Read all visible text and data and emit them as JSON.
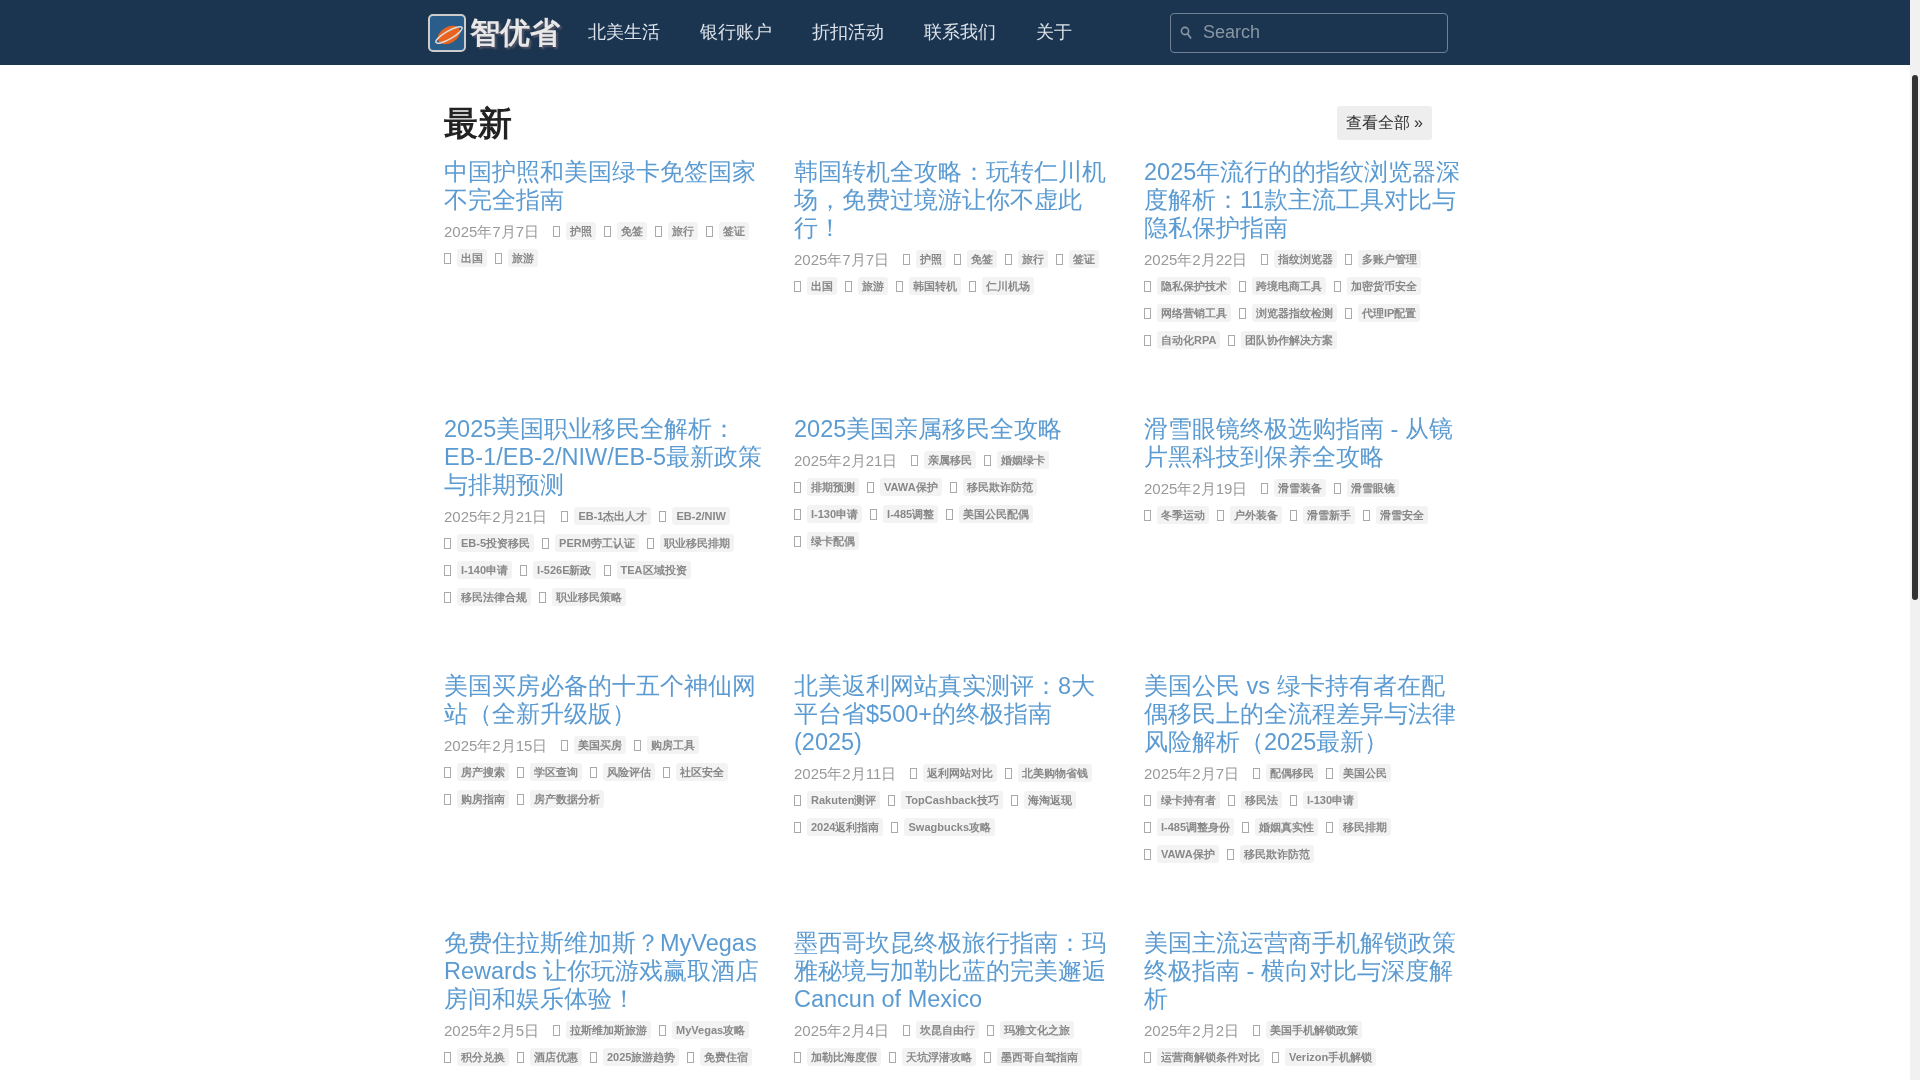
{
  "navbar": {
    "brand": "智优省",
    "menu": [
      "北美生活",
      "银行账户",
      "折扣活动",
      "联系我们",
      "关于"
    ],
    "search": {
      "placeholder": "Search"
    }
  },
  "section": {
    "title": "最新",
    "view_all": "查看全部 »"
  },
  "articles": [
    {
      "title": "中国护照和美国绿卡免签国家不完全指南",
      "date": "2025年7月7日",
      "tags": [
        "护照",
        "免签",
        "旅行",
        "签证",
        "出国",
        "旅游"
      ]
    },
    {
      "title": "韩国转机全攻略：玩转仁川机场，免费过境游让你不虚此行！",
      "date": "2025年7月7日",
      "tags": [
        "护照",
        "免签",
        "旅行",
        "签证",
        "出国",
        "旅游",
        "韩国转机",
        "仁川机场"
      ]
    },
    {
      "title": "2025年流行的的指纹浏览器深度解析：11款主流工具对比与隐私保护指南",
      "date": "2025年2月22日",
      "tags": [
        "指纹浏览器",
        "多账户管理",
        "隐私保护技术",
        "跨境电商工具",
        "加密货币安全",
        "网络营销工具",
        "浏览器指纹检测",
        "代理IP配置",
        "自动化RPA",
        "团队协作解决方案"
      ]
    },
    {
      "title": "2025美国职业移民全解析：EB-1/EB-2/NIW/EB-5最新政策与排期预测",
      "date": "2025年2月21日",
      "tags": [
        "EB-1杰出人才",
        "EB-2/NIW",
        "EB-5投资移民",
        "PERM劳工认证",
        "职业移民排期",
        "I-140申请",
        "I-526E新政",
        "TEA区域投资",
        "移民法律合规",
        "职业移民策略"
      ]
    },
    {
      "title": "2025美国亲属移民全攻略",
      "date": "2025年2月21日",
      "tags": [
        "亲属移民",
        "婚姻绿卡",
        "排期预测",
        "VAWA保护",
        "移民欺诈防范",
        "I-130申请",
        "I-485调整",
        "美国公民配偶",
        "绿卡配偶"
      ]
    },
    {
      "title": "滑雪眼镜终极选购指南 - 从镜片黑科技到保养全攻略",
      "date": "2025年2月19日",
      "tags": [
        "滑雪装备",
        "滑雪眼镜",
        "冬季运动",
        "户外装备",
        "滑雪新手",
        "滑雪安全"
      ]
    },
    {
      "title": "美国买房必备的十五个神仙网站（全新升级版）",
      "date": "2025年2月15日",
      "tags": [
        "美国买房",
        "购房工具",
        "房产搜索",
        "学区查询",
        "风险评估",
        "社区安全",
        "购房指南",
        "房产数据分析"
      ]
    },
    {
      "title": "北美返利网站真实测评：8大平台省$500+的终极指南(2025)",
      "date": "2025年2月11日",
      "tags": [
        "返利网站对比",
        "北美购物省钱",
        "Rakuten测评",
        "TopCashback技巧",
        "海淘返现",
        "2024返利指南",
        "Swagbucks攻略"
      ]
    },
    {
      "title": "美国公民 vs 绿卡持有者在配偶移民上的全流程差异与法律风险解析（2025最新）",
      "date": "2025年2月7日",
      "tags": [
        "配偶移民",
        "美国公民",
        "绿卡持有者",
        "移民法",
        "I-130申请",
        "I-485调整身份",
        "婚姻真实性",
        "移民排期",
        "VAWA保护",
        "移民欺诈防范"
      ]
    },
    {
      "title": "免费住拉斯维加斯？MyVegas Rewards 让你玩游戏赢取酒店房间和娱乐体验！",
      "date": "2025年2月5日",
      "tags": [
        "拉斯维加斯旅游",
        "MyVegas攻略",
        "积分兑换",
        "酒店优惠",
        "2025旅游趋势",
        "免费住宿"
      ]
    },
    {
      "title": "墨西哥坎昆终极旅行指南：玛雅秘境与加勒比蓝的完美邂逅Cancun of Mexico",
      "date": "2025年2月4日",
      "tags": [
        "坎昆自由行",
        "玛雅文化之旅",
        "加勒比海度假",
        "天坑浮潜攻略",
        "墨西哥自驾指南"
      ]
    },
    {
      "title": "美国主流运营商手机解锁政策终极指南 - 横向对比与深度解析",
      "date": "2025年2月2日",
      "tags": [
        "美国手机解锁政策",
        "运营商解锁条件对比",
        "Verizon手机解锁"
      ]
    }
  ]
}
